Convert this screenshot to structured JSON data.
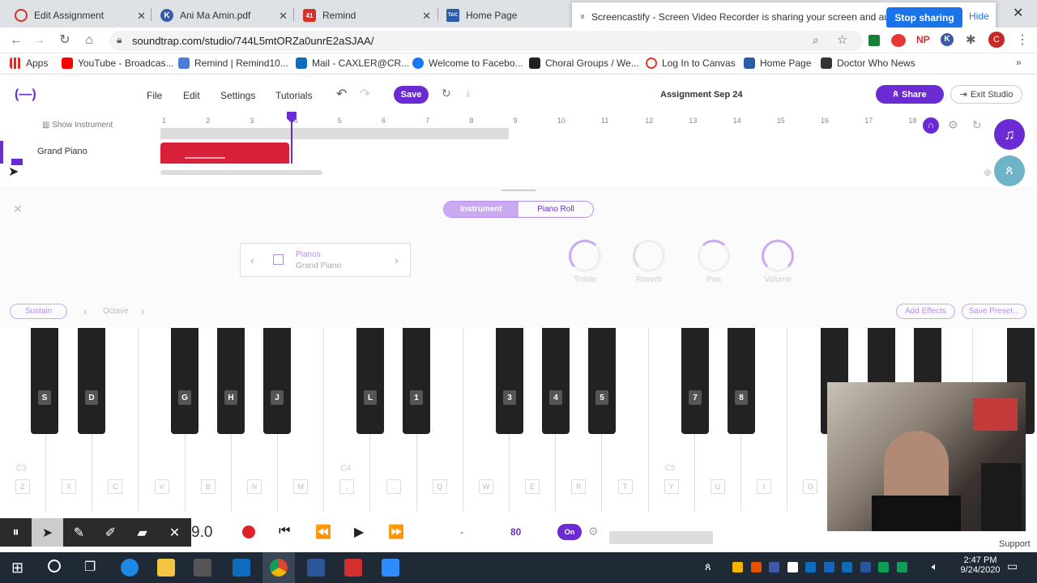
{
  "browser": {
    "tabs": [
      {
        "title": "Edit Assignment",
        "color": "#d93025",
        "glyph": ""
      },
      {
        "title": "Ani Ma Amin.pdf",
        "color": "#3b5aa9",
        "glyph": "K"
      },
      {
        "title": "Remind",
        "color": "#d93025",
        "glyph": "41"
      },
      {
        "title": "Home Page",
        "color": "#2a5ca8",
        "glyph": "TAC"
      }
    ],
    "url": "soundtrap.com/studio/744L5mtORZa0unrE2aSJAA/",
    "sharing_notice": "Screencastify - Screen Video Recorder is sharing your screen and audio.",
    "stop_sharing": "Stop sharing",
    "hide": "Hide",
    "bookmarks": [
      {
        "label": "Apps",
        "color": "#5f6368"
      },
      {
        "label": "YouTube - Broadcas...",
        "color": "#ff0000"
      },
      {
        "label": "Remind | Remind10...",
        "color": "#4a7cd9"
      },
      {
        "label": "Mail - CAXLER@CR...",
        "color": "#0f6cbd"
      },
      {
        "label": "Welcome to Facebo...",
        "color": "#1877f2"
      },
      {
        "label": "Choral Groups / We...",
        "color": "#222"
      },
      {
        "label": "Log In to Canvas",
        "color": "#e33a2a"
      },
      {
        "label": "Home Page",
        "color": "#2a5ca8"
      },
      {
        "label": "Doctor Who News",
        "color": "#333"
      }
    ],
    "profile_initial": "C"
  },
  "studio": {
    "menu": [
      "File",
      "Edit",
      "Settings",
      "Tutorials"
    ],
    "save": "Save",
    "assignment": "Assignment Sep 24",
    "share": "Share",
    "exit": "Exit Studio",
    "show_instrument": "Show Instrument",
    "track_name": "Grand Piano",
    "ruler": [
      "1",
      "2",
      "3",
      "4",
      "5",
      "6",
      "7",
      "8",
      "9",
      "10",
      "11",
      "12",
      "13",
      "14",
      "15",
      "16",
      "17",
      "18"
    ]
  },
  "instrument_panel": {
    "tabs": [
      "Instrument",
      "Piano Roll"
    ],
    "category": "Pianos",
    "instrument": "Grand Piano",
    "knobs": [
      "Treble",
      "Reverb",
      "Pan",
      "Volume"
    ],
    "sustain": "Sustain",
    "octave": "Octave",
    "add_effects": "Add Effects",
    "save_preset": "Save Preset..."
  },
  "keyboard": {
    "black_keys": [
      "S",
      "D",
      "G",
      "H",
      "J",
      "L",
      "1",
      "3",
      "4",
      "5",
      "7",
      "8"
    ],
    "white_keys": [
      "Z",
      "X",
      "C",
      "V",
      "B",
      "N",
      "M",
      ",",
      ".",
      "Q",
      "W",
      "E",
      "R",
      "T",
      "Y",
      "U",
      "I",
      "O"
    ],
    "octave_labels": [
      "C3",
      "C4",
      "C5"
    ]
  },
  "transport": {
    "time": "9.0",
    "dash": "-",
    "tempo": "80",
    "metronome": "On",
    "support": "Support"
  },
  "taskbar": {
    "time": "2:47 PM",
    "date": "9/24/2020"
  },
  "colors": {
    "brand": "#6a2bd2",
    "record": "#e0202a",
    "clip": "#d9203a"
  }
}
